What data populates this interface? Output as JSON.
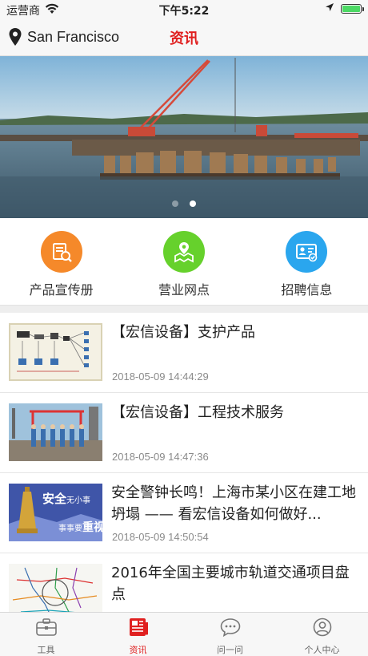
{
  "status_bar": {
    "carrier": "运营商",
    "time": "下午5:22",
    "battery_level": 1.0
  },
  "nav": {
    "location": "San Francisco",
    "title": "资讯"
  },
  "banner": {
    "slide_count": 2,
    "active_slide": 2
  },
  "shortcuts": [
    {
      "label": "产品宣传册",
      "icon": "brochure-icon",
      "color": "#f5892a"
    },
    {
      "label": "营业网点",
      "icon": "map-location-icon",
      "color": "#66d12c"
    },
    {
      "label": "招聘信息",
      "icon": "id-card-icon",
      "color": "#2aa6ee"
    }
  ],
  "news": [
    {
      "title": "【宏信设备】支护产品",
      "date": "2018-05-09 14:44:29",
      "thumb": "diagram-thumbnail"
    },
    {
      "title": "【宏信设备】工程技术服务",
      "date": "2018-05-09 14:47:36",
      "thumb": "workers-site-thumbnail"
    },
    {
      "title": "安全警钟长鸣！上海市某小区在建工地坍塌 —— 看宏信设备如何做好...",
      "date": "2018-05-09 14:50:54",
      "thumb": "safety-bell-thumbnail",
      "thumb_text_1": "安全",
      "thumb_text_2": "无小事",
      "thumb_text_3": "事事要",
      "thumb_text_4": "重视"
    },
    {
      "title": "2016年全国主要城市轨道交通项目盘点",
      "date": "",
      "thumb": "metro-map-thumbnail"
    }
  ],
  "tabs": [
    {
      "label": "工具",
      "icon": "toolbox-icon",
      "active": false
    },
    {
      "label": "资讯",
      "icon": "newspaper-icon",
      "active": true
    },
    {
      "label": "问一问",
      "icon": "chat-bubble-icon",
      "active": false
    },
    {
      "label": "个人中心",
      "icon": "user-icon",
      "active": false
    }
  ],
  "colors": {
    "accent": "#e02020",
    "inactive": "#666666"
  }
}
